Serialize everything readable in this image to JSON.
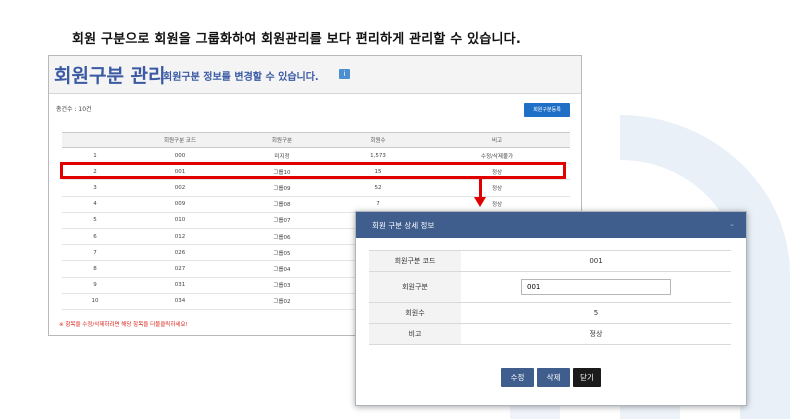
{
  "headline": "회원 구분으로 회원을 그룹화하여 회원관리를 보다 편리하게 관리할 수 있습니다.",
  "panel": {
    "title": "회원구분 관리",
    "subtitle": "회원구분 정보를 변경할 수 있습니다.",
    "info_icon": "info-icon",
    "total_label": "총건수 : 10건",
    "add_button": "회원구분등록",
    "table": {
      "headers": [
        "",
        "회원구분 코드",
        "회원구분",
        "회원수",
        "비고"
      ],
      "rows": [
        [
          "1",
          "000",
          "미지정",
          "1,573",
          "수정/삭제불가"
        ],
        [
          "2",
          "001",
          "그룹10",
          "15",
          "정상"
        ],
        [
          "3",
          "002",
          "그룹09",
          "52",
          "정상"
        ],
        [
          "4",
          "009",
          "그룹08",
          "7",
          "정상"
        ],
        [
          "5",
          "010",
          "그룹07",
          "",
          ""
        ],
        [
          "6",
          "012",
          "그룹06",
          "",
          ""
        ],
        [
          "7",
          "026",
          "그룹05",
          "",
          ""
        ],
        [
          "8",
          "027",
          "그룹04",
          "",
          ""
        ],
        [
          "9",
          "031",
          "그룹03",
          "",
          ""
        ],
        [
          "10",
          "034",
          "그룹02",
          "",
          ""
        ]
      ]
    },
    "note": "※ 항목을 수정/삭제하려면 해당 항목을 더블클릭하세요!"
  },
  "modal": {
    "title": "회원 구분 상세 정보",
    "close_icon": "chevron-down-icon",
    "fields": {
      "code_label": "회원구분 코드",
      "code_value": "001",
      "group_label": "회원구분",
      "group_value": "001",
      "count_label": "회원수",
      "count_value": "5",
      "note_label": "비고",
      "note_value": "정상"
    },
    "buttons": {
      "edit": "수정",
      "delete": "삭제",
      "close": "닫기"
    }
  },
  "colors": {
    "accent": "#3a5aa3",
    "primary_button": "#1f6fc7",
    "modal_header": "#3f5d8d",
    "highlight": "#e00000"
  }
}
